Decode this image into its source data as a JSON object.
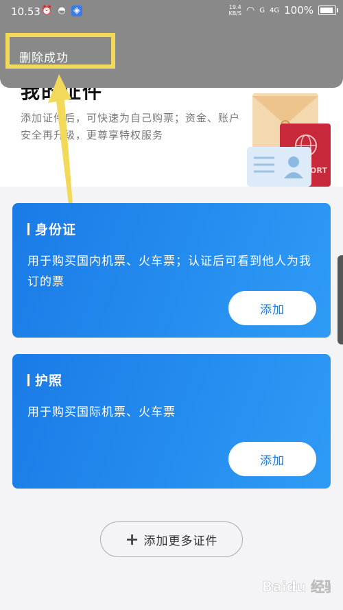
{
  "status_bar": {
    "time": "10.53",
    "speed_value": "19.4",
    "speed_unit": "KB/S",
    "signal_a": "G",
    "signal_b": "4G",
    "battery": "100%"
  },
  "toast": {
    "message": "删除成功"
  },
  "header": {
    "title": "我的证件",
    "subtitle": "添加证件后，可快速为自己购票；资金、账户安全再升级，更尊享特权服务"
  },
  "cards": [
    {
      "title": "身份证",
      "description": "用于购买国内机票、火车票；认证后可看到他人为我订的票",
      "button": "添加"
    },
    {
      "title": "护照",
      "description": "用于购买国际机票、火车票",
      "button": "添加"
    }
  ],
  "more_button": {
    "label": "添加更多证件"
  },
  "illustration": {
    "passport_text": "ORT"
  },
  "watermark": {
    "text": "Baidu 经验"
  },
  "colors": {
    "card_gradient_start": "#1a7be7",
    "card_gradient_end": "#2e9bf6",
    "highlight": "#f2d95a",
    "toast_bg": "#8a898a"
  }
}
